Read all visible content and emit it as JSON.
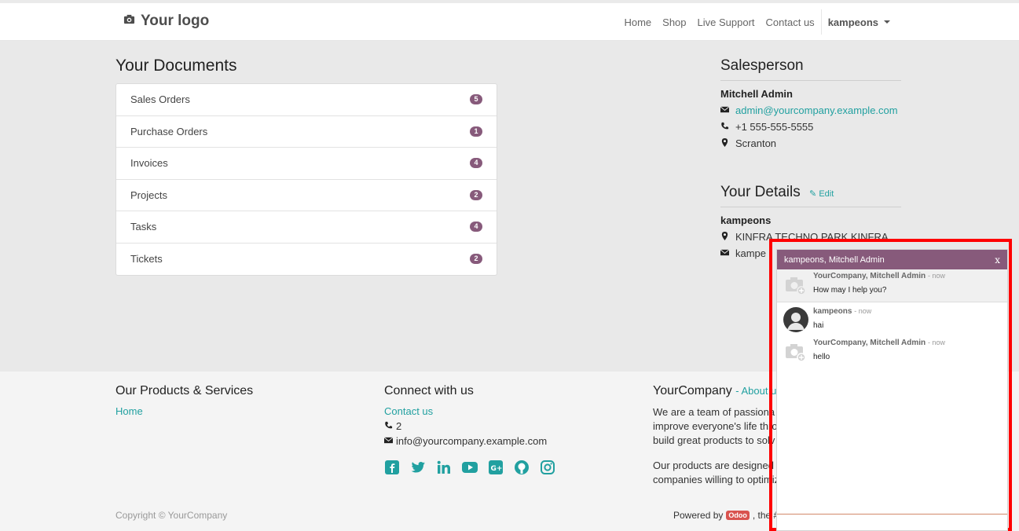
{
  "header": {
    "logo": "Your logo",
    "nav": [
      "Home",
      "Shop",
      "Live Support",
      "Contact us"
    ],
    "user": "kampeons"
  },
  "documents": {
    "title": "Your Documents",
    "items": [
      {
        "label": "Sales Orders",
        "count": "5"
      },
      {
        "label": "Purchase Orders",
        "count": "1"
      },
      {
        "label": "Invoices",
        "count": "4"
      },
      {
        "label": "Projects",
        "count": "2"
      },
      {
        "label": "Tasks",
        "count": "4"
      },
      {
        "label": "Tickets",
        "count": "2"
      }
    ]
  },
  "salesperson": {
    "title": "Salesperson",
    "name": "Mitchell Admin",
    "email": "admin@yourcompany.example.com",
    "phone": "+1 555-555-5555",
    "city": "Scranton"
  },
  "details": {
    "title": "Your Details",
    "edit": "Edit",
    "name": "kampeons",
    "address": "KINFRA TECHNO PARK KINFRA",
    "email": "kampe"
  },
  "footer": {
    "products_title": "Our Products & Services",
    "products_link": "Home",
    "connect_title": "Connect with us",
    "contact_link": "Contact us",
    "phone": "2",
    "email": "info@yourcompany.example.com",
    "company_title": "YourCompany",
    "about_link": "- About us",
    "about_p1_l1": "We are a team of passiona",
    "about_p1_l2": "improve everyone's life thro",
    "about_p1_l3": "build great products to solv",
    "about_p2_l1": "Our products are designed fo",
    "about_p2_l2": "companies willing to optimiz",
    "copyright": "Copyright © YourCompany",
    "powered_by": "Powered by",
    "odoo": "Odoo",
    "powered_tail": ", the #"
  },
  "chat": {
    "title": "kampeons, Mitchell Admin",
    "close": "x",
    "messages": [
      {
        "author": "YourCompany, Mitchell Admin",
        "time": "- now",
        "text": "How may I help you?"
      },
      {
        "author": "kampeons",
        "time": "- now",
        "text": "hai"
      },
      {
        "author": "YourCompany, Mitchell Admin",
        "time": "- now",
        "text": "hello"
      }
    ]
  },
  "colors": {
    "brand": "#875a7b",
    "link": "#21a0a0",
    "highlight": "#ff0000"
  },
  "icons": [
    "camera-icon",
    "envelope-icon",
    "phone-icon",
    "map-marker-icon",
    "pencil-icon",
    "facebook-icon",
    "twitter-icon",
    "linkedin-icon",
    "youtube-icon",
    "google-plus-icon",
    "github-icon",
    "instagram-icon",
    "avatar-placeholder-icon",
    "user-avatar"
  ]
}
